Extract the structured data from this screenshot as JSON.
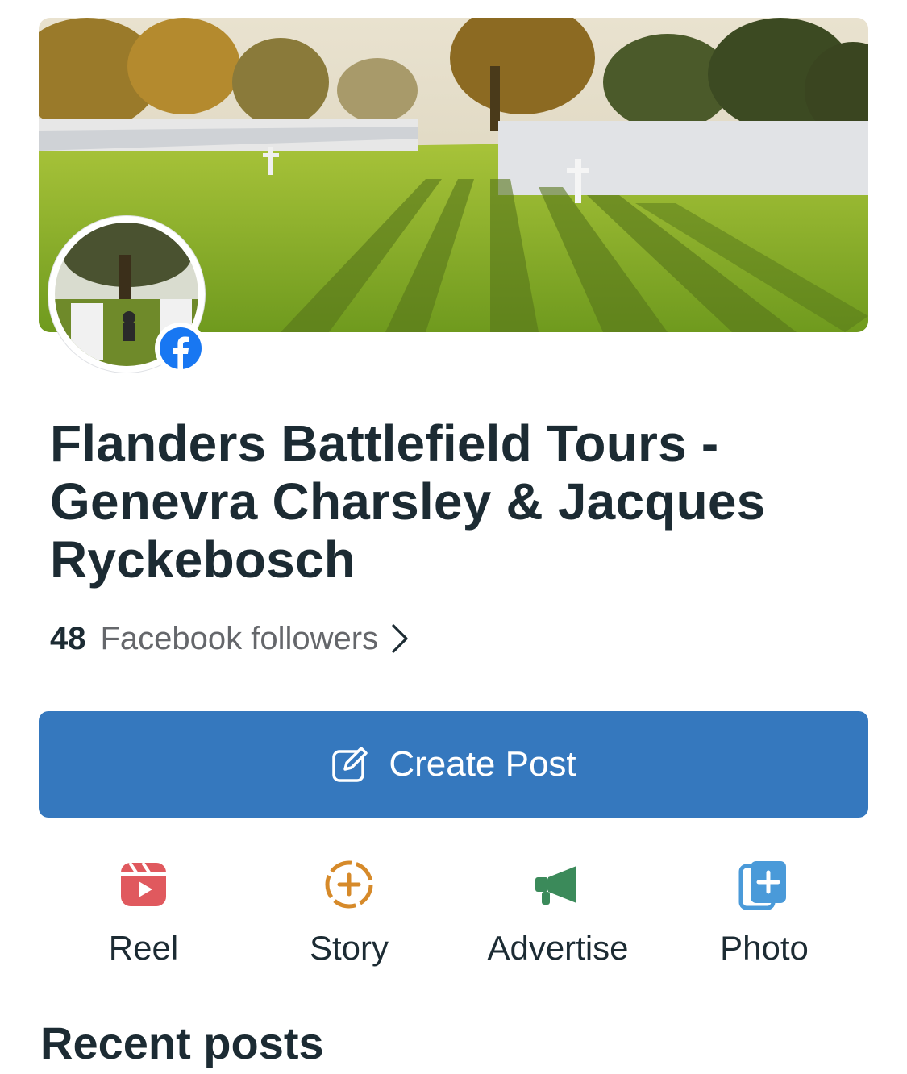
{
  "page": {
    "title": "Flanders Battlefield Tours - Genevra Charsley & Jacques Ryckebosch",
    "followers_count": "48",
    "followers_label": "Facebook followers"
  },
  "cover_photo": {
    "description": "cemetery-cover-photo"
  },
  "profile_photo": {
    "description": "cemetery-profile-photo",
    "badge_icon": "facebook-icon"
  },
  "primary_action": {
    "label": "Create Post",
    "icon": "edit-icon"
  },
  "actions": [
    {
      "label": "Reel",
      "icon": "reel-icon",
      "color": "#e0595e"
    },
    {
      "label": "Story",
      "icon": "story-add-icon",
      "color": "#d68a2a"
    },
    {
      "label": "Advertise",
      "icon": "megaphone-icon",
      "color": "#3b8a5a"
    },
    {
      "label": "Photo",
      "icon": "photo-add-icon",
      "color": "#4a9ad9"
    }
  ],
  "sections": {
    "recent_posts_title": "Recent posts"
  },
  "colors": {
    "primary_button": "#3578be",
    "facebook_blue": "#1877f2",
    "text_primary": "#1c2b33",
    "text_secondary": "#65676b"
  }
}
